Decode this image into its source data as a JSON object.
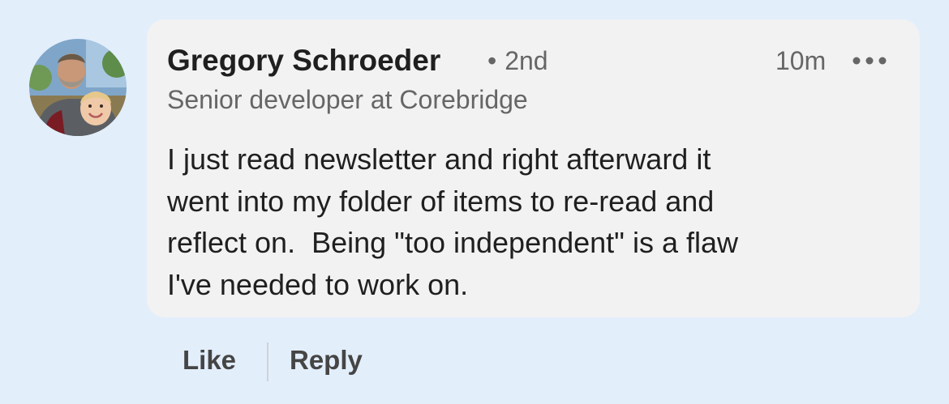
{
  "comment": {
    "author": {
      "name": "Gregory Schroeder",
      "connection_separator": "•",
      "connection_degree": "2nd",
      "headline": "Senior developer at Corebridge",
      "avatar_icon": "profile-photo"
    },
    "timestamp": "10m",
    "more_icon": "ellipsis-icon",
    "text": "I just read newsletter and right afterward it\nwent into my folder of items to re-read and\nreflect on.  Being \"too independent\" is a flaw\nI've needed to work on."
  },
  "actions": {
    "like_label": "Like",
    "reply_label": "Reply"
  },
  "colors": {
    "background": "#e3eefb",
    "bubble": "#f2f2f2",
    "primary_text": "#1f1f1f",
    "secondary_text": "#666666",
    "action_text": "#454545"
  }
}
